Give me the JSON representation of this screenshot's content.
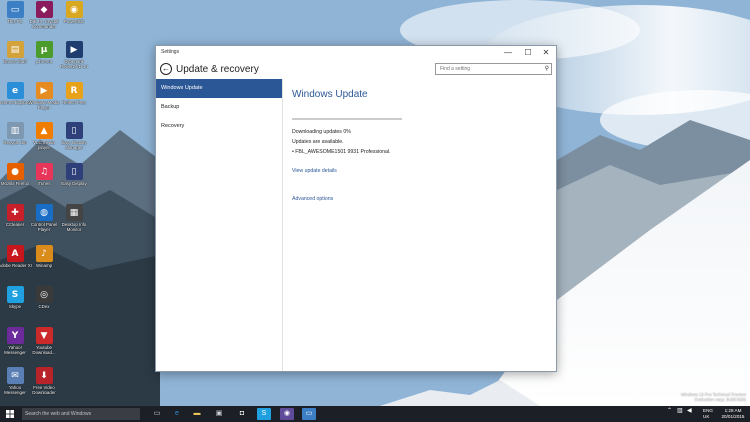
{
  "desktop": {
    "icons": [
      {
        "label": "This PC",
        "glyph": "▭",
        "color": "#3c7fc4",
        "icon": "computer-icon"
      },
      {
        "label": "DIE Pt. Crystal Commander",
        "glyph": "◆",
        "color": "#8a1c5e",
        "icon": "media-app-icon"
      },
      {
        "label": "PowerISO",
        "glyph": "◉",
        "color": "#d8a820",
        "icon": "disc-icon"
      },
      {
        "label": "Dave's Stuff",
        "glyph": "▤",
        "color": "#d3a23a",
        "icon": "folder-icon"
      },
      {
        "label": "µTorrent",
        "glyph": "µ",
        "color": "#4c9b2d",
        "icon": "utorrent-icon"
      },
      {
        "label": "CyberLink PowerDVD 14",
        "glyph": "▶",
        "color": "#1f3e6f",
        "icon": "powerdvd-icon"
      },
      {
        "label": "Internet Explorer",
        "glyph": "e",
        "color": "#2a8fd8",
        "icon": "internet-explorer-icon"
      },
      {
        "label": "Windows Media Player",
        "glyph": "▶",
        "color": "#e58b1f",
        "icon": "media-player-icon"
      },
      {
        "label": "Reflect Free",
        "glyph": "R",
        "color": "#e8a21a",
        "icon": "reflect-icon"
      },
      {
        "label": "Recycle Bin",
        "glyph": "▥",
        "color": "#7f98b2",
        "icon": "recycle-bin-icon"
      },
      {
        "label": "VLC media player",
        "glyph": "▲",
        "color": "#f07c00",
        "icon": "vlc-icon"
      },
      {
        "label": "Easy Display Manager",
        "glyph": "▯",
        "color": "#2e3f7a",
        "icon": "display-manager-icon"
      },
      {
        "label": "Mozilla Firefox",
        "glyph": "●",
        "color": "#e66000",
        "icon": "firefox-icon"
      },
      {
        "label": "iTunes",
        "glyph": "♫",
        "color": "#e8355a",
        "icon": "itunes-icon"
      },
      {
        "label": "Easy Display",
        "glyph": "▯",
        "color": "#2e3f7a",
        "icon": "easy-display-icon"
      },
      {
        "label": "CCleaner",
        "glyph": "✚",
        "color": "#c8202a",
        "icon": "ccleaner-icon"
      },
      {
        "label": "Control Panel Player",
        "glyph": "◍",
        "color": "#1a6dc4",
        "icon": "control-panel-icon"
      },
      {
        "label": "Desktop Info Monitor",
        "glyph": "▦",
        "color": "#444444",
        "icon": "monitor-icon"
      },
      {
        "label": "Adobe Reader XI",
        "glyph": "A",
        "color": "#c8161d",
        "icon": "adobe-reader-icon"
      },
      {
        "label": "Winamp",
        "glyph": "♪",
        "color": "#d98c1a",
        "icon": "winamp-icon"
      },
      {
        "label": "Skype",
        "glyph": "S",
        "color": "#1fa1e1",
        "icon": "skype-icon"
      },
      {
        "label": "CDex",
        "glyph": "◎",
        "color": "#3a3a3a",
        "icon": "cdex-icon"
      },
      {
        "label": "Yahoo! Messenger",
        "glyph": "Y",
        "color": "#6b2b9a",
        "icon": "yahoo-icon"
      },
      {
        "label": "Youtube Download...",
        "glyph": "▼",
        "color": "#cc2a2a",
        "icon": "youtube-download-icon"
      },
      {
        "label": "Yahoo Messenger",
        "glyph": "✉",
        "color": "#5a7fb5",
        "icon": "messenger-icon"
      },
      {
        "label": "Free Video Downloader",
        "glyph": "⬇",
        "color": "#b8232a",
        "icon": "video-downloader-icon"
      }
    ]
  },
  "window": {
    "titlebar_text": "Settings",
    "minimize_label": "—",
    "maximize_label": "☐",
    "close_label": "✕",
    "back_glyph": "←",
    "header_title": "Update & recovery",
    "search_placeholder": "Find a setting",
    "search_glyph": "⚲",
    "sidebar": {
      "items": [
        {
          "label": "Windows Update",
          "active": true
        },
        {
          "label": "Backup",
          "active": false
        },
        {
          "label": "Recovery",
          "active": false
        }
      ]
    },
    "content": {
      "title": "Windows Update",
      "progress_fraction": 0.0,
      "status_line1": "Downloading updates 0%",
      "status_line2": "Updates are available.",
      "status_line3": "• FBL_AWESOME1501 9931 Professional.",
      "link_view_details": "View update details",
      "link_advanced": "Advanced options"
    }
  },
  "taskbar": {
    "search_placeholder": "Search the web and Windows",
    "language": "ENG",
    "region": "UK",
    "time": "1:28 AM",
    "date": "20/01/2015"
  },
  "watermark": {
    "line1": "Windows 10 Pro Technical Preview",
    "line2": "Evaluation copy. Build 9926"
  },
  "colors": {
    "accent": "#2b5797",
    "taskbar_bg": "#1c1f26"
  }
}
